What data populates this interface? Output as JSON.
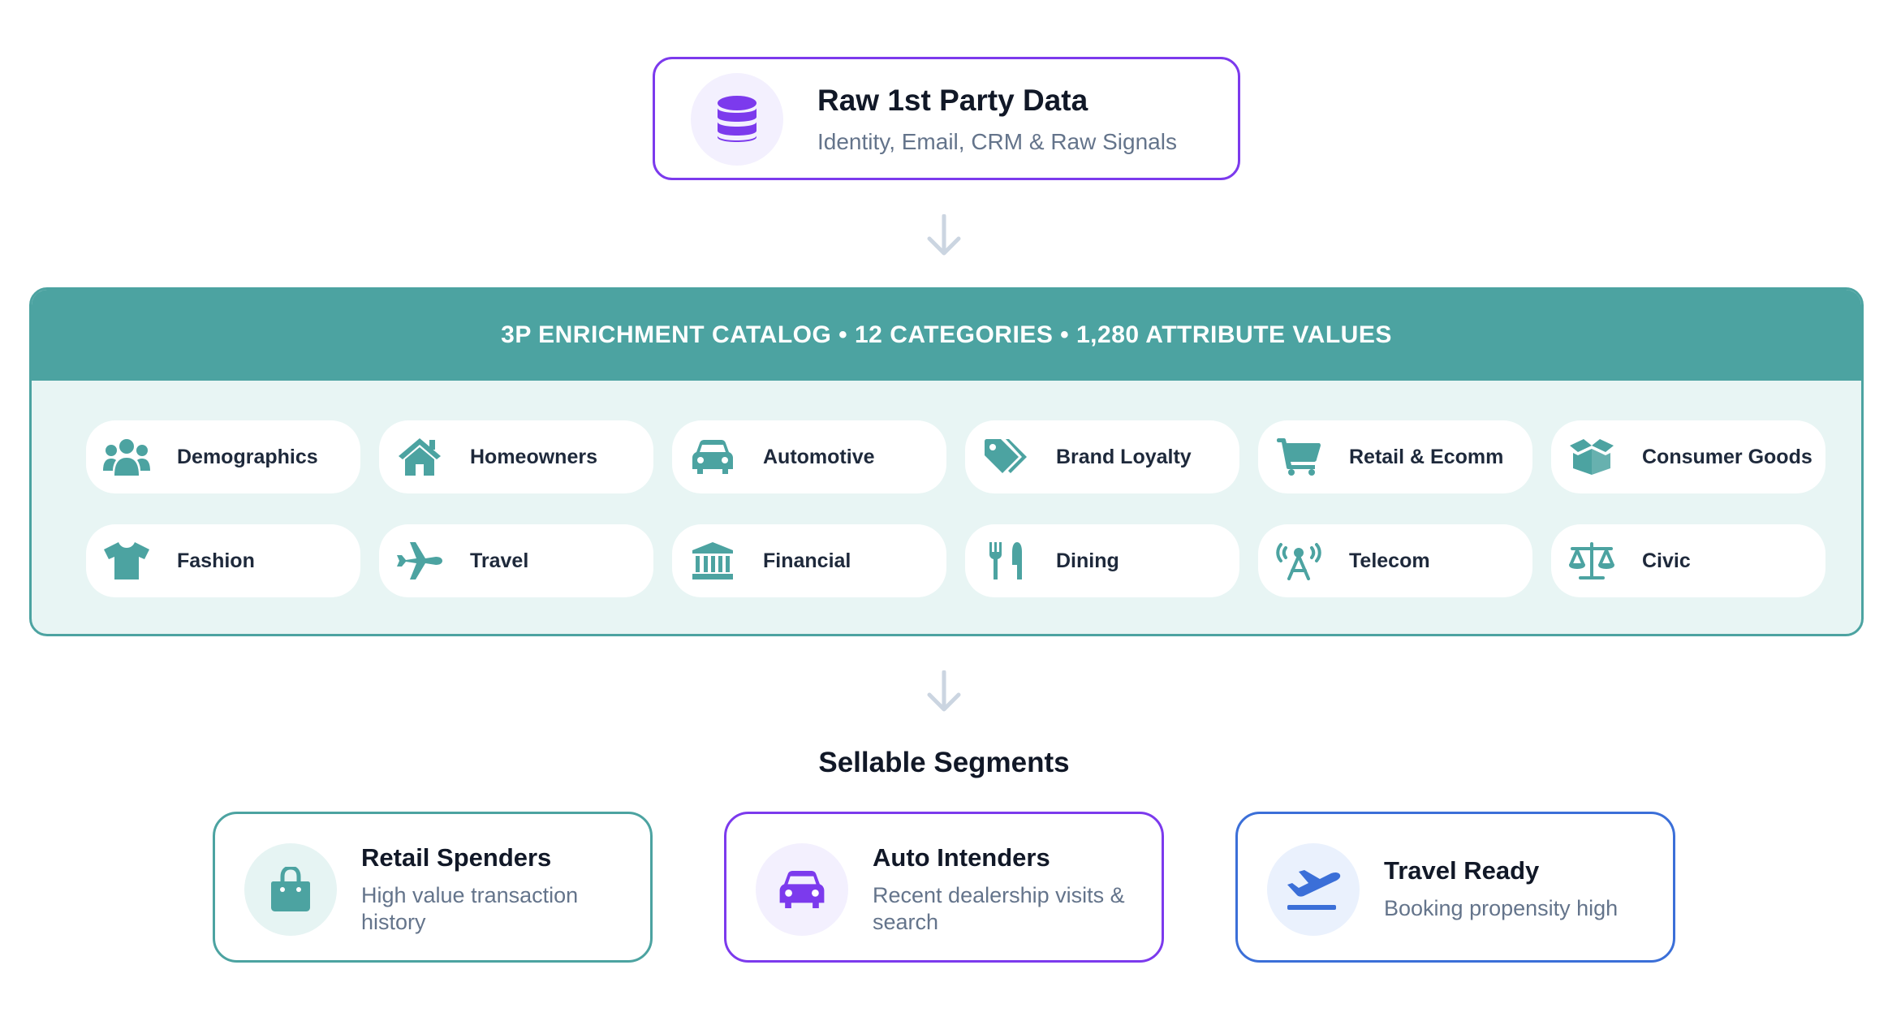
{
  "source": {
    "title": "Raw 1st Party Data",
    "subtitle": "Identity, Email, CRM & Raw Signals",
    "icon": "database-icon"
  },
  "catalog": {
    "title": "3P ENRICHMENT CATALOG • 12 CATEGORIES • 1,280 ATTRIBUTE VALUES",
    "categories": [
      {
        "label": "Demographics",
        "icon": "users-icon"
      },
      {
        "label": "Homeowners",
        "icon": "house-icon"
      },
      {
        "label": "Automotive",
        "icon": "car-icon"
      },
      {
        "label": "Brand Loyalty",
        "icon": "tags-icon"
      },
      {
        "label": "Retail & Ecomm",
        "icon": "cart-icon"
      },
      {
        "label": "Consumer Goods",
        "icon": "box-open-icon"
      },
      {
        "label": "Fashion",
        "icon": "shirt-icon"
      },
      {
        "label": "Travel",
        "icon": "plane-icon"
      },
      {
        "label": "Financial",
        "icon": "bank-icon"
      },
      {
        "label": "Dining",
        "icon": "utensils-icon"
      },
      {
        "label": "Telecom",
        "icon": "tower-icon"
      },
      {
        "label": "Civic",
        "icon": "scale-icon"
      }
    ]
  },
  "segments": {
    "title": "Sellable Segments",
    "items": [
      {
        "title": "Retail Spenders",
        "description": "High value transaction history",
        "icon": "shopping-bag-icon"
      },
      {
        "title": "Auto Intenders",
        "description": "Recent dealership visits & search",
        "icon": "car-icon"
      },
      {
        "title": "Travel Ready",
        "description": "Booking propensity high",
        "icon": "plane-departure-icon"
      }
    ]
  },
  "colors": {
    "teal": "#4ca3a1",
    "purple": "#7c3aed",
    "blue": "#3b6fd8",
    "arrow": "#cbd5e1"
  }
}
